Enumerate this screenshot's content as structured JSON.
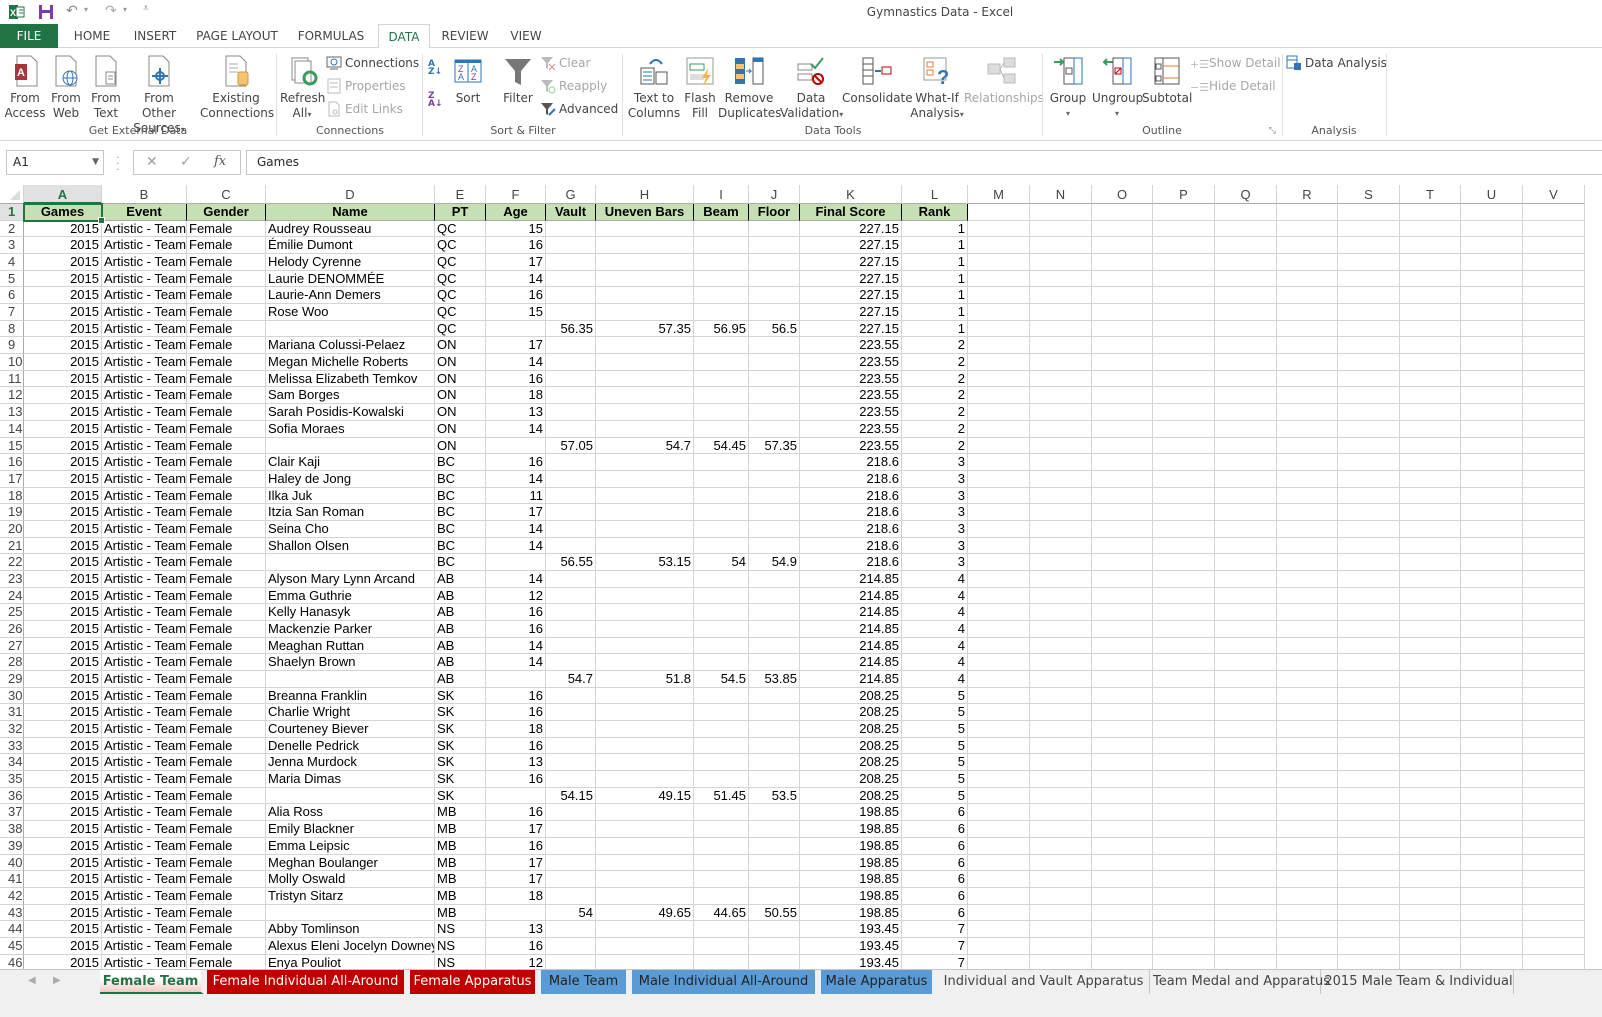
{
  "window": {
    "title": "Gymnastics Data - Excel"
  },
  "ribbon_tabs": [
    {
      "label": "FILE"
    },
    {
      "label": "HOME"
    },
    {
      "label": "INSERT"
    },
    {
      "label": "PAGE LAYOUT"
    },
    {
      "label": "FORMULAS"
    },
    {
      "label": "DATA"
    },
    {
      "label": "REVIEW"
    },
    {
      "label": "VIEW"
    }
  ],
  "active_tab": "DATA",
  "ribbon": {
    "get_external_data": {
      "label": "Get External Data",
      "from_access": [
        "From",
        "Access"
      ],
      "from_web": [
        "From",
        "Web"
      ],
      "from_text": [
        "From",
        "Text"
      ],
      "from_other": [
        "From Other",
        "Sources"
      ],
      "existing": [
        "Existing",
        "Connections"
      ]
    },
    "connections": {
      "label": "Connections",
      "refresh_all": [
        "Refresh",
        "All"
      ],
      "connections": "Connections",
      "properties": "Properties",
      "edit_links": "Edit Links"
    },
    "sort_filter": {
      "label": "Sort & Filter",
      "sort": "Sort",
      "filter": "Filter",
      "clear": "Clear",
      "reapply": "Reapply",
      "advanced": "Advanced"
    },
    "data_tools": {
      "label": "Data Tools",
      "text_to_columns": [
        "Text to",
        "Columns"
      ],
      "flash_fill": [
        "Flash",
        "Fill"
      ],
      "remove_duplicates": [
        "Remove",
        "Duplicates"
      ],
      "data_validation": [
        "Data",
        "Validation"
      ],
      "consolidate": "Consolidate",
      "what_if": [
        "What-If",
        "Analysis"
      ],
      "relationships": "Relationships"
    },
    "outline": {
      "label": "Outline",
      "group": "Group",
      "ungroup": "Ungroup",
      "subtotal": "Subtotal",
      "show_detail": "Show Detail",
      "hide_detail": "Hide Detail"
    },
    "analysis": {
      "label": "Analysis",
      "data_analysis": "Data Analysis"
    }
  },
  "formula_bar": {
    "name_box": "A1",
    "formula": "Games"
  },
  "grid": {
    "columns": [
      "A",
      "B",
      "C",
      "D",
      "E",
      "F",
      "G",
      "H",
      "I",
      "J",
      "K",
      "L",
      "M",
      "N",
      "O",
      "P",
      "Q",
      "R",
      "S",
      "T",
      "U",
      "V"
    ],
    "selected_cell": "A1",
    "headers": [
      "Games",
      "Event",
      "Gender",
      "Name",
      "PT",
      "Age",
      "Vault",
      "Uneven Bars",
      "Beam",
      "Floor",
      "Final Score",
      "Rank"
    ],
    "rows": [
      [
        "2015",
        "Artistic - Team",
        "Female",
        "Audrey Rousseau",
        "QC",
        "15",
        "",
        "",
        "",
        "",
        "227.15",
        "1"
      ],
      [
        "2015",
        "Artistic - Team",
        "Female",
        "Émilie Dumont",
        "QC",
        "16",
        "",
        "",
        "",
        "",
        "227.15",
        "1"
      ],
      [
        "2015",
        "Artistic - Team",
        "Female",
        "Helody Cyrenne",
        "QC",
        "17",
        "",
        "",
        "",
        "",
        "227.15",
        "1"
      ],
      [
        "2015",
        "Artistic - Team",
        "Female",
        "Laurie DENOMMÉE",
        "QC",
        "14",
        "",
        "",
        "",
        "",
        "227.15",
        "1"
      ],
      [
        "2015",
        "Artistic - Team",
        "Female",
        "Laurie-Ann Demers",
        "QC",
        "16",
        "",
        "",
        "",
        "",
        "227.15",
        "1"
      ],
      [
        "2015",
        "Artistic - Team",
        "Female",
        "Rose Woo",
        "QC",
        "15",
        "",
        "",
        "",
        "",
        "227.15",
        "1"
      ],
      [
        "2015",
        "Artistic - Team",
        "Female",
        "",
        "QC",
        "",
        "56.35",
        "57.35",
        "56.95",
        "56.5",
        "227.15",
        "1"
      ],
      [
        "2015",
        "Artistic - Team",
        "Female",
        "Mariana Colussi-Pelaez",
        "ON",
        "17",
        "",
        "",
        "",
        "",
        "223.55",
        "2"
      ],
      [
        "2015",
        "Artistic - Team",
        "Female",
        "Megan Michelle Roberts",
        "ON",
        "14",
        "",
        "",
        "",
        "",
        "223.55",
        "2"
      ],
      [
        "2015",
        "Artistic - Team",
        "Female",
        "Melissa Elizabeth Temkov",
        "ON",
        "16",
        "",
        "",
        "",
        "",
        "223.55",
        "2"
      ],
      [
        "2015",
        "Artistic - Team",
        "Female",
        "Sam Borges",
        "ON",
        "18",
        "",
        "",
        "",
        "",
        "223.55",
        "2"
      ],
      [
        "2015",
        "Artistic - Team",
        "Female",
        "Sarah Posidis-Kowalski",
        "ON",
        "13",
        "",
        "",
        "",
        "",
        "223.55",
        "2"
      ],
      [
        "2015",
        "Artistic - Team",
        "Female",
        "Sofia Moraes",
        "ON",
        "14",
        "",
        "",
        "",
        "",
        "223.55",
        "2"
      ],
      [
        "2015",
        "Artistic - Team",
        "Female",
        "",
        "ON",
        "",
        "57.05",
        "54.7",
        "54.45",
        "57.35",
        "223.55",
        "2"
      ],
      [
        "2015",
        "Artistic - Team",
        "Female",
        "Clair Kaji",
        "BC",
        "16",
        "",
        "",
        "",
        "",
        "218.6",
        "3"
      ],
      [
        "2015",
        "Artistic - Team",
        "Female",
        "Haley de Jong",
        "BC",
        "14",
        "",
        "",
        "",
        "",
        "218.6",
        "3"
      ],
      [
        "2015",
        "Artistic - Team",
        "Female",
        "Ilka Juk",
        "BC",
        "11",
        "",
        "",
        "",
        "",
        "218.6",
        "3"
      ],
      [
        "2015",
        "Artistic - Team",
        "Female",
        "Itzia San Roman",
        "BC",
        "17",
        "",
        "",
        "",
        "",
        "218.6",
        "3"
      ],
      [
        "2015",
        "Artistic - Team",
        "Female",
        "Seina Cho",
        "BC",
        "14",
        "",
        "",
        "",
        "",
        "218.6",
        "3"
      ],
      [
        "2015",
        "Artistic - Team",
        "Female",
        "Shallon Olsen",
        "BC",
        "14",
        "",
        "",
        "",
        "",
        "218.6",
        "3"
      ],
      [
        "2015",
        "Artistic - Team",
        "Female",
        "",
        "BC",
        "",
        "56.55",
        "53.15",
        "54",
        "54.9",
        "218.6",
        "3"
      ],
      [
        "2015",
        "Artistic - Team",
        "Female",
        "Alyson Mary Lynn Arcand",
        "AB",
        "14",
        "",
        "",
        "",
        "",
        "214.85",
        "4"
      ],
      [
        "2015",
        "Artistic - Team",
        "Female",
        "Emma Guthrie",
        "AB",
        "12",
        "",
        "",
        "",
        "",
        "214.85",
        "4"
      ],
      [
        "2015",
        "Artistic - Team",
        "Female",
        "Kelly Hanasyk",
        "AB",
        "16",
        "",
        "",
        "",
        "",
        "214.85",
        "4"
      ],
      [
        "2015",
        "Artistic - Team",
        "Female",
        "Mackenzie Parker",
        "AB",
        "16",
        "",
        "",
        "",
        "",
        "214.85",
        "4"
      ],
      [
        "2015",
        "Artistic - Team",
        "Female",
        "Meaghan Ruttan",
        "AB",
        "14",
        "",
        "",
        "",
        "",
        "214.85",
        "4"
      ],
      [
        "2015",
        "Artistic - Team",
        "Female",
        "Shaelyn Brown",
        "AB",
        "14",
        "",
        "",
        "",
        "",
        "214.85",
        "4"
      ],
      [
        "2015",
        "Artistic - Team",
        "Female",
        "",
        "AB",
        "",
        "54.7",
        "51.8",
        "54.5",
        "53.85",
        "214.85",
        "4"
      ],
      [
        "2015",
        "Artistic - Team",
        "Female",
        "Breanna Franklin",
        "SK",
        "16",
        "",
        "",
        "",
        "",
        "208.25",
        "5"
      ],
      [
        "2015",
        "Artistic - Team",
        "Female",
        "Charlie Wright",
        "SK",
        "16",
        "",
        "",
        "",
        "",
        "208.25",
        "5"
      ],
      [
        "2015",
        "Artistic - Team",
        "Female",
        "Courteney Biever",
        "SK",
        "18",
        "",
        "",
        "",
        "",
        "208.25",
        "5"
      ],
      [
        "2015",
        "Artistic - Team",
        "Female",
        "Denelle Pedrick",
        "SK",
        "16",
        "",
        "",
        "",
        "",
        "208.25",
        "5"
      ],
      [
        "2015",
        "Artistic - Team",
        "Female",
        "Jenna Murdock",
        "SK",
        "13",
        "",
        "",
        "",
        "",
        "208.25",
        "5"
      ],
      [
        "2015",
        "Artistic - Team",
        "Female",
        "Maria Dimas",
        "SK",
        "16",
        "",
        "",
        "",
        "",
        "208.25",
        "5"
      ],
      [
        "2015",
        "Artistic - Team",
        "Female",
        "",
        "SK",
        "",
        "54.15",
        "49.15",
        "51.45",
        "53.5",
        "208.25",
        "5"
      ],
      [
        "2015",
        "Artistic - Team",
        "Female",
        "Alia Ross",
        "MB",
        "16",
        "",
        "",
        "",
        "",
        "198.85",
        "6"
      ],
      [
        "2015",
        "Artistic - Team",
        "Female",
        "Emily Blackner",
        "MB",
        "17",
        "",
        "",
        "",
        "",
        "198.85",
        "6"
      ],
      [
        "2015",
        "Artistic - Team",
        "Female",
        "Emma Leipsic",
        "MB",
        "16",
        "",
        "",
        "",
        "",
        "198.85",
        "6"
      ],
      [
        "2015",
        "Artistic - Team",
        "Female",
        "Meghan Boulanger",
        "MB",
        "17",
        "",
        "",
        "",
        "",
        "198.85",
        "6"
      ],
      [
        "2015",
        "Artistic - Team",
        "Female",
        "Molly Oswald",
        "MB",
        "17",
        "",
        "",
        "",
        "",
        "198.85",
        "6"
      ],
      [
        "2015",
        "Artistic - Team",
        "Female",
        "Tristyn Sitarz",
        "MB",
        "18",
        "",
        "",
        "",
        "",
        "198.85",
        "6"
      ],
      [
        "2015",
        "Artistic - Team",
        "Female",
        "",
        "MB",
        "",
        "54",
        "49.65",
        "44.65",
        "50.55",
        "198.85",
        "6"
      ],
      [
        "2015",
        "Artistic - Team",
        "Female",
        "Abby Tomlinson",
        "NS",
        "13",
        "",
        "",
        "",
        "",
        "193.45",
        "7"
      ],
      [
        "2015",
        "Artistic - Team",
        "Female",
        "Alexus Eleni Jocelyn Downey",
        "NS",
        "16",
        "",
        "",
        "",
        "",
        "193.45",
        "7"
      ],
      [
        "2015",
        "Artistic - Team",
        "Female",
        "Enya Pouliot",
        "NS",
        "12",
        "",
        "",
        "",
        "",
        "193.45",
        "7"
      ]
    ]
  },
  "sheet_tabs": [
    {
      "label": "Female Team",
      "color": "active"
    },
    {
      "label": "Female Individual All-Around",
      "color": "red"
    },
    {
      "label": "Female Apparatus",
      "color": "red"
    },
    {
      "label": "Male Team",
      "color": "blue"
    },
    {
      "label": "Male Individual All-Around",
      "color": "blue"
    },
    {
      "label": "Male Apparatus",
      "color": "blue"
    },
    {
      "label": "Individual and Vault Apparatus",
      "color": "plain"
    },
    {
      "label": "Team Medal and Apparatus",
      "color": "plain"
    },
    {
      "label": "2015 Male Team & Individual",
      "color": "plain"
    }
  ],
  "colors": {
    "excel_green": "#217346",
    "header_fill": "#c6e0b4",
    "tab_red": "#c00000",
    "tab_blue": "#5b9bd5"
  }
}
